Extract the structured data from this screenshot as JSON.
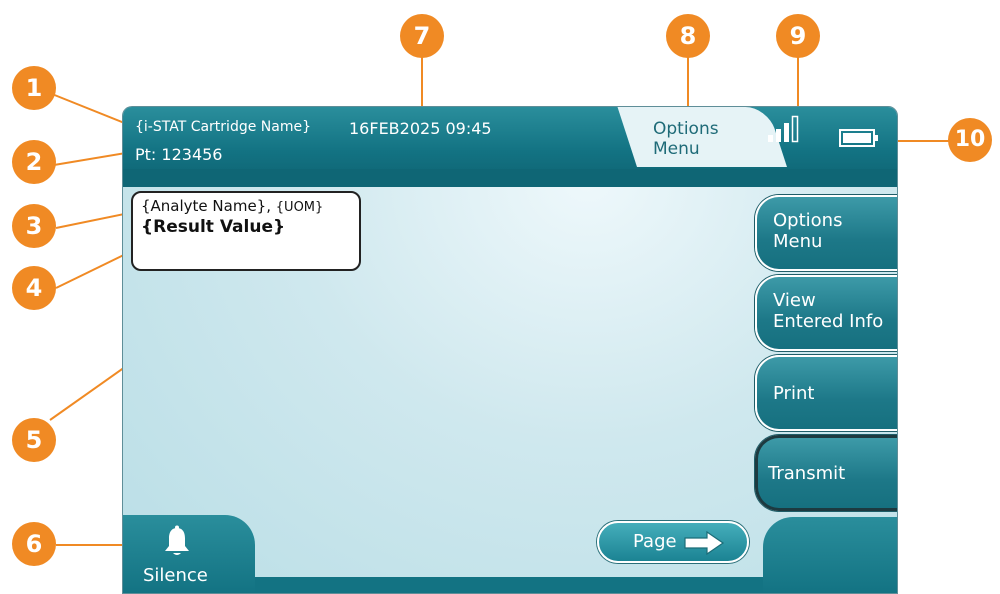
{
  "header": {
    "cartridge_name": "{i-STAT Cartridge Name}",
    "patient_id": "Pt: 123456",
    "datetime": "16FEB2025 09:45",
    "options_tab": [
      "Options",
      "Menu"
    ]
  },
  "result_card": {
    "analyte_name": "{Analyte Name},",
    "uom": "{UOM}",
    "result_value": "{Result Value}"
  },
  "side_buttons": [
    {
      "line1": "Options",
      "line2": "Menu"
    },
    {
      "line1": "View",
      "line2": "Entered Info"
    },
    {
      "line1": "Print",
      "line2": ""
    },
    {
      "line1": "Transmit",
      "line2": ""
    }
  ],
  "footer": {
    "silence_label": "Silence",
    "page_label": "Page"
  },
  "callouts": [
    "1",
    "2",
    "3",
    "4",
    "5",
    "6",
    "7",
    "8",
    "9",
    "10"
  ],
  "status": {
    "signal_bars_filled": 3,
    "signal_bars_total": 4,
    "battery_level": 1.0
  },
  "colors": {
    "teal": "#137383",
    "callout": "#f08a24",
    "screen_bg": "#cfe8ee"
  },
  "icons": [
    "bell-icon",
    "arrow-right-icon",
    "signal-icon",
    "battery-icon"
  ]
}
